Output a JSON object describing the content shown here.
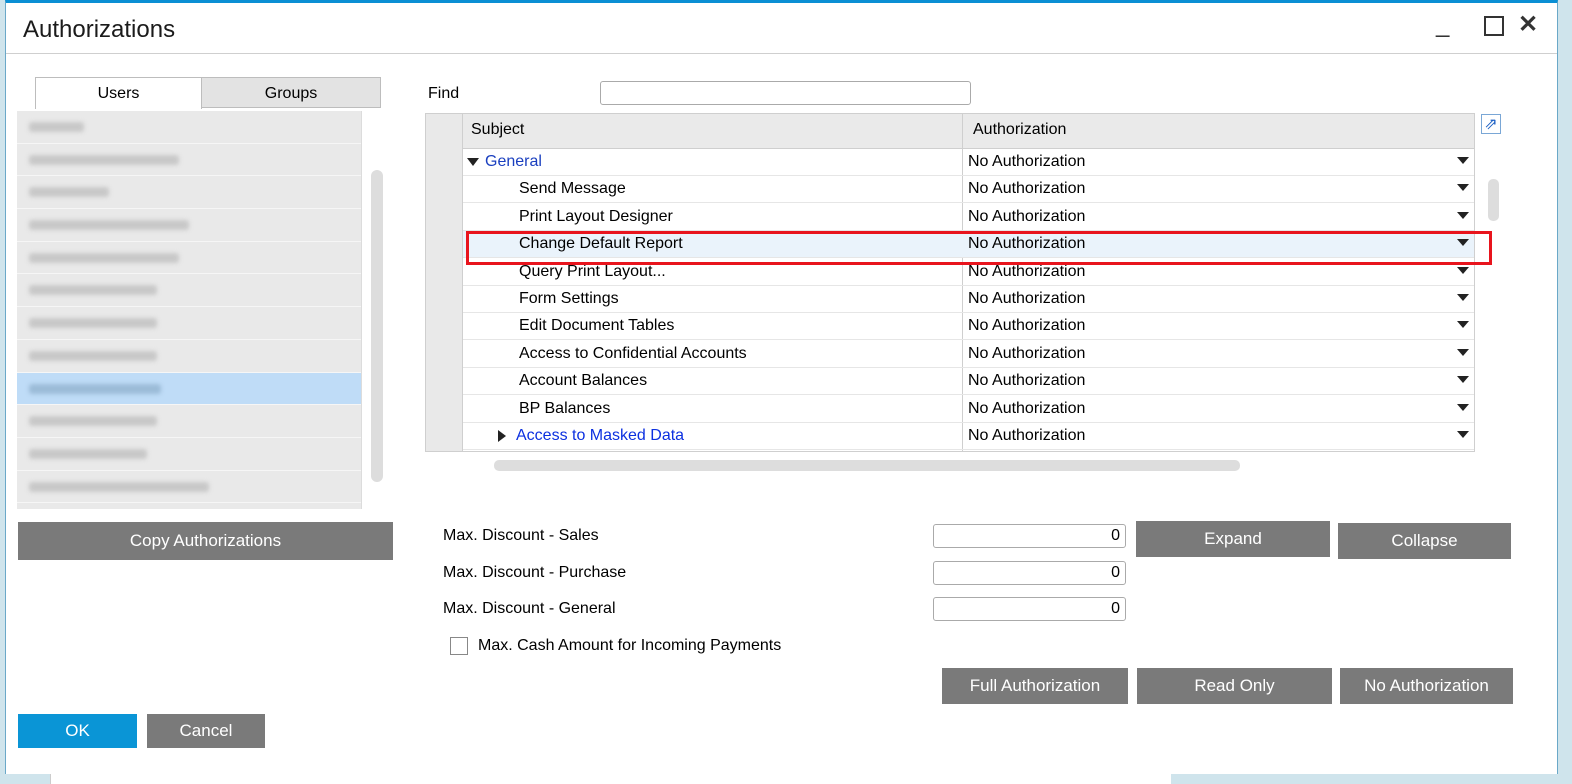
{
  "window": {
    "title": "Authorizations",
    "controls": {
      "minimize": "_",
      "close": "✕"
    }
  },
  "tabs": [
    {
      "label": "Users"
    },
    {
      "label": "Groups"
    }
  ],
  "users": {
    "selected_index": 8,
    "count": 12
  },
  "find": {
    "label": "Find",
    "value": ""
  },
  "grid": {
    "columns": {
      "subject": "Subject",
      "authorization": "Authorization"
    },
    "rows": [
      {
        "subject": "General",
        "authorization": "No Authorization",
        "level": 0,
        "expanded": true,
        "link": true
      },
      {
        "subject": "Send Message",
        "authorization": "No Authorization",
        "level": 1
      },
      {
        "subject": "Print Layout Designer",
        "authorization": "No Authorization",
        "level": 1
      },
      {
        "subject": "Change Default Report",
        "authorization": "No Authorization",
        "level": 1,
        "highlighted": true
      },
      {
        "subject": "Query Print Layout...",
        "authorization": "No Authorization",
        "level": 1
      },
      {
        "subject": "Form Settings",
        "authorization": "No Authorization",
        "level": 1
      },
      {
        "subject": "Edit Document Tables",
        "authorization": "No Authorization",
        "level": 1
      },
      {
        "subject": "Access to Confidential Accounts",
        "authorization": "No Authorization",
        "level": 1
      },
      {
        "subject": "Account Balances",
        "authorization": "No Authorization",
        "level": 1
      },
      {
        "subject": "BP Balances",
        "authorization": "No Authorization",
        "level": 1
      },
      {
        "subject": "Access to Masked Data",
        "authorization": "No Authorization",
        "level": 1,
        "collapsed": true,
        "link": true
      }
    ]
  },
  "discounts": {
    "sales": {
      "label": "Max. Discount - Sales",
      "value": "0"
    },
    "purchase": {
      "label": "Max. Discount - Purchase",
      "value": "0"
    },
    "general": {
      "label": "Max. Discount - General",
      "value": "0"
    }
  },
  "cash": {
    "label": "Max. Cash Amount for Incoming Payments",
    "checked": false
  },
  "buttons": {
    "copy": "Copy Authorizations",
    "expand": "Expand",
    "collapse": "Collapse",
    "full": "Full Authorization",
    "read_only": "Read Only",
    "no_auth": "No Authorization",
    "ok": "OK",
    "cancel": "Cancel"
  },
  "colors": {
    "accent": "#0a95d6",
    "button_gray": "#7a7a7a",
    "highlight": "#e8141d",
    "selection": "#bfdcf7"
  },
  "icons": [
    "minimize-icon",
    "maximize-icon",
    "close-icon",
    "expand-arrow-icon",
    "dropdown-arrow-icon",
    "tree-expanded-icon",
    "tree-collapsed-icon"
  ]
}
